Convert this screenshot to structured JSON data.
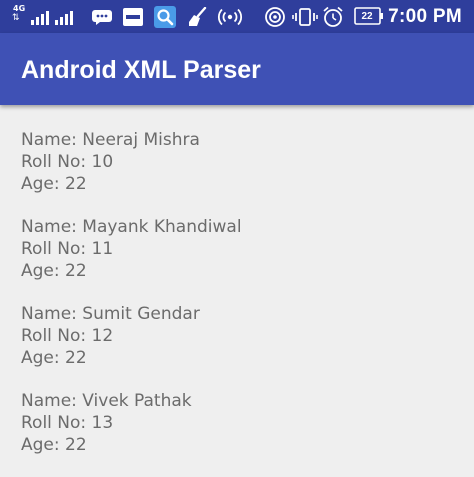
{
  "status_bar": {
    "network_type": "4G",
    "time": "7:00 PM",
    "battery_level": "22",
    "icons": [
      "upload-download-arrows-icon",
      "signal-bars-icon",
      "signal-bars-icon",
      "message-icon",
      "paytm-icon",
      "search-icon",
      "cleaner-broom-icon",
      "hotspot-broadcast-icon",
      "wifi-hotspot-icon",
      "vibrate-icon",
      "alarm-icon",
      "battery-icon"
    ]
  },
  "app_bar": {
    "title": "Android XML Parser",
    "color": "#3f51b5"
  },
  "records": [
    {
      "name": "Name: Neeraj Mishra",
      "roll": "Roll No: 10",
      "age": "Age: 22"
    },
    {
      "name": "Name: Mayank Khandiwal",
      "roll": "Roll No: 11",
      "age": "Age: 22"
    },
    {
      "name": "Name: Sumit Gendar",
      "roll": "Roll No: 12",
      "age": "Age: 22"
    },
    {
      "name": "Name: Vivek Pathak",
      "roll": "Roll No: 13",
      "age": "Age: 22"
    }
  ],
  "colors": {
    "status_bar": "#2f3e9c",
    "background": "#efefef",
    "text": "#6b6b6b"
  }
}
